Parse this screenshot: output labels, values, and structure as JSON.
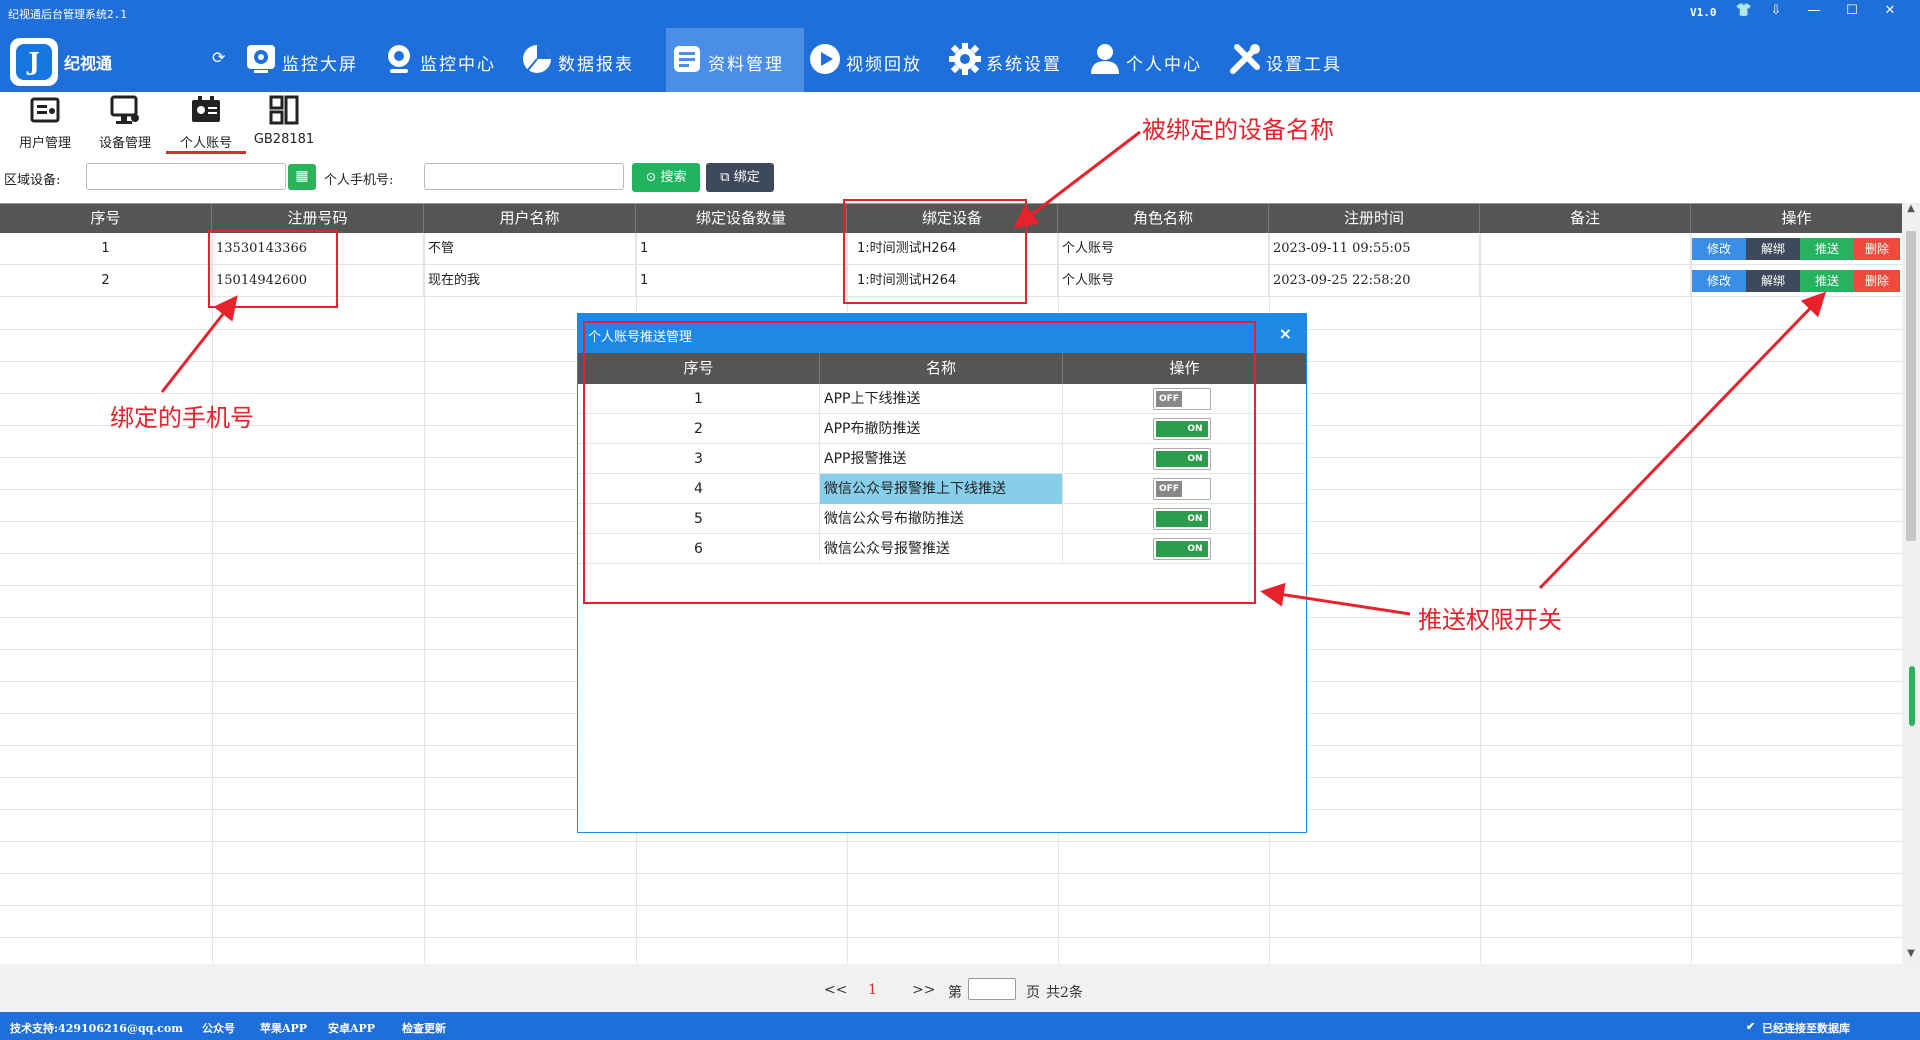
{
  "window": {
    "title": "纪视通后台管理系统2.1",
    "version": "V1.0",
    "controls": [
      "⇩",
      "—",
      "☐",
      "✕"
    ]
  },
  "brand": {
    "name": "纪视通",
    "logo_letter": "J"
  },
  "nav": {
    "items": [
      {
        "label": "监控大屏",
        "icon": "monitor-screen-icon"
      },
      {
        "label": "监控中心",
        "icon": "camera-icon"
      },
      {
        "label": "数据报表",
        "icon": "pie-chart-icon"
      },
      {
        "label": "资料管理",
        "icon": "document-icon",
        "active": true
      },
      {
        "label": "视频回放",
        "icon": "play-icon"
      },
      {
        "label": "系统设置",
        "icon": "gear-icon"
      },
      {
        "label": "个人中心",
        "icon": "user-icon"
      },
      {
        "label": "设置工具",
        "icon": "tools-icon"
      }
    ]
  },
  "subtools": {
    "items": [
      {
        "label": "用户管理",
        "icon": "user-management-icon"
      },
      {
        "label": "设备管理",
        "icon": "device-management-icon"
      },
      {
        "label": "个人账号",
        "icon": "personal-account-icon",
        "active": true
      },
      {
        "label": "GB28181",
        "icon": "gb28181-icon"
      }
    ]
  },
  "filters": {
    "region_label": "区域设备:",
    "region_value": "",
    "phone_label": "个人手机号:",
    "phone_value": "",
    "search_label": "搜索",
    "bind_label": "绑定"
  },
  "table": {
    "columns": [
      "序号",
      "注册号码",
      "用户名称",
      "绑定设备数量",
      "绑定设备",
      "角色名称",
      "注册时间",
      "备注",
      "操作"
    ],
    "rows": [
      {
        "index": "1",
        "phone": "13530143366",
        "name": "不管",
        "count": "1",
        "device": "1:时间测试H264",
        "role": "个人账号",
        "time": "2023-09-11 09:55:05",
        "note": ""
      },
      {
        "index": "2",
        "phone": "15014942600",
        "name": "现在的我",
        "count": "1",
        "device": "1:时间测试H264",
        "role": "个人账号",
        "time": "2023-09-25 22:58:20",
        "note": ""
      }
    ],
    "actions": [
      {
        "label": "修改",
        "color": "#3a8ee6"
      },
      {
        "label": "解绑",
        "color": "#3e4a5c"
      },
      {
        "label": "推送",
        "color": "#25b35f"
      },
      {
        "label": "删除",
        "color": "#f04a3c"
      }
    ]
  },
  "pager": {
    "prev": "<<",
    "current": "1",
    "next": ">>",
    "page_label": "第",
    "page_value": "",
    "page_suffix": "页",
    "total": "共2条"
  },
  "status": {
    "support": "技术支持:429106216@qq.com",
    "wechat": "公众号",
    "ios": "苹果APP",
    "android": "安卓APP",
    "update": "检查更新",
    "connection": "已经连接至数据库"
  },
  "dialog": {
    "title": "个人账号推送管理",
    "close": "×",
    "columns": [
      "序号",
      "名称",
      "操作"
    ],
    "rows": [
      {
        "index": "1",
        "name": "APP上下线推送",
        "state": "OFF"
      },
      {
        "index": "2",
        "name": "APP布撤防推送",
        "state": "ON"
      },
      {
        "index": "3",
        "name": "APP报警推送",
        "state": "ON"
      },
      {
        "index": "4",
        "name": "微信公众号报警推上下线推送",
        "state": "OFF",
        "selected": true
      },
      {
        "index": "5",
        "name": "微信公众号布撤防推送",
        "state": "ON"
      },
      {
        "index": "6",
        "name": "微信公众号报警推送",
        "state": "ON"
      }
    ]
  },
  "annotations": {
    "bound_device": "被绑定的设备名称",
    "bound_phone": "绑定的手机号",
    "push_switch": "推送权限开关",
    "color": "#e8222c"
  }
}
